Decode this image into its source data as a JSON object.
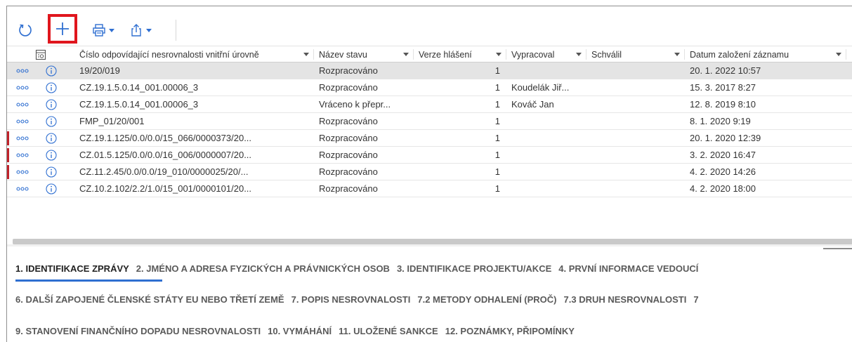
{
  "toolbar": {
    "refresh_icon": "refresh-icon",
    "add_icon": "plus-icon",
    "print_icon": "print-icon",
    "export_icon": "share-export-icon",
    "highlight_color": "#e0161d",
    "accent_color": "#2f6fd1"
  },
  "table": {
    "columns": [
      "Číslo odpovídající nesrovnalosti vnitřní úrovně",
      "Název stavu",
      "Verze hlášení",
      "Vypracoval",
      "Schválil",
      "Datum založení záznamu"
    ],
    "rows": [
      {
        "cislo": "19/20/019",
        "stav": "Rozpracováno",
        "verze": "1",
        "vypracoval": "",
        "schvalil": "",
        "datum": "20. 1. 2022 10:57",
        "selected": true,
        "flagged": false
      },
      {
        "cislo": "CZ.19.1.5.0.14_001.00006_3",
        "stav": "Rozpracováno",
        "verze": "1",
        "vypracoval": "Koudelák Jiř...",
        "schvalil": "",
        "datum": "15. 3. 2017 8:27",
        "selected": false,
        "flagged": false
      },
      {
        "cislo": "CZ.19.1.5.0.14_001.00006_3",
        "stav": "Vráceno k přepr...",
        "verze": "1",
        "vypracoval": "Kováč Jan",
        "schvalil": "",
        "datum": "12. 8. 2019 8:10",
        "selected": false,
        "flagged": false
      },
      {
        "cislo": "FMP_01/20/001",
        "stav": "Rozpracováno",
        "verze": "1",
        "vypracoval": "",
        "schvalil": "",
        "datum": "8. 1. 2020 9:19",
        "selected": false,
        "flagged": false
      },
      {
        "cislo": "CZ.19.1.125/0.0/0.0/15_066/0000373/20...",
        "stav": "Rozpracováno",
        "verze": "1",
        "vypracoval": "",
        "schvalil": "",
        "datum": "20. 1. 2020 12:39",
        "selected": false,
        "flagged": true
      },
      {
        "cislo": "CZ.01.5.125/0.0/0.0/16_006/0000007/20...",
        "stav": "Rozpracováno",
        "verze": "1",
        "vypracoval": "",
        "schvalil": "",
        "datum": "3. 2. 2020 16:47",
        "selected": false,
        "flagged": true
      },
      {
        "cislo": "CZ.11.2.45/0.0/0.0/19_010/0000025/20/...",
        "stav": "Rozpracováno",
        "verze": "1",
        "vypracoval": "",
        "schvalil": "",
        "datum": "4. 2. 2020 14:26",
        "selected": false,
        "flagged": true
      },
      {
        "cislo": "CZ.10.2.102/2.2/1.0/15_001/0000101/20...",
        "stav": "Rozpracováno",
        "verze": "1",
        "vypracoval": "",
        "schvalil": "",
        "datum": "4. 2. 2020 18:00",
        "selected": false,
        "flagged": false
      }
    ],
    "flag_color": "#c0232b"
  },
  "tabs": {
    "line1": [
      "1. IDENTIFIKACE ZPRÁVY",
      "2. JMÉNO A ADRESA FYZICKÝCH A PRÁVNICKÝCH OSOB",
      "3. IDENTIFIKACE PROJEKTU/AKCE",
      "4. PRVNÍ INFORMACE VEDOUCÍ"
    ],
    "line2": [
      "6. DALŠÍ ZAPOJENÉ ČLENSKÉ STÁTY EU NEBO TŘETÍ ZEMĚ",
      "7. POPIS NESROVNALOSTI",
      "7.2 METODY ODHALENÍ (PROČ)",
      "7.3 DRUH NESROVNALOSTI",
      "7"
    ],
    "line3": [
      "9. STANOVENÍ FINANČNÍHO DOPADU NESROVNALOSTI",
      "10. VYMÁHÁNÍ",
      "11. ULOŽENÉ SANKCE",
      "12. POZNÁMKY, PŘIPOMÍNKY"
    ],
    "active": "1. IDENTIFIKACE ZPRÁVY"
  }
}
